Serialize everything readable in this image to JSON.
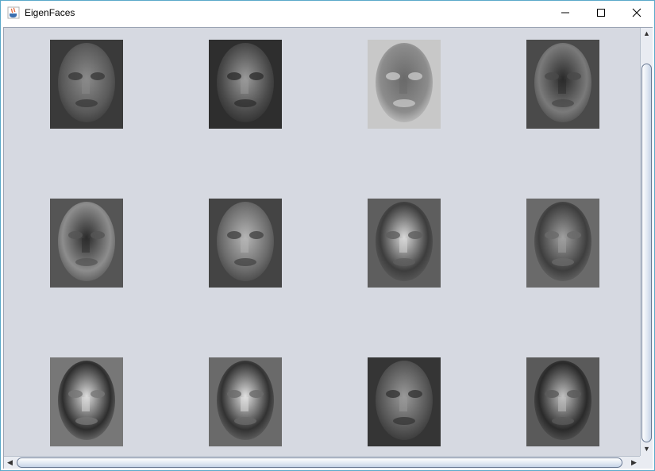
{
  "window": {
    "title": "EigenFaces",
    "icon": "java-coffee-cup-icon"
  },
  "controls": {
    "minimize_icon": "minimize-icon",
    "maximize_icon": "maximize-icon",
    "close_icon": "close-icon"
  },
  "eigenfaces": {
    "rows": 3,
    "columns": 4,
    "count": 12
  },
  "scrollbars": {
    "vertical": {
      "up_icon": "arrow-up-icon",
      "down_icon": "arrow-down-icon"
    },
    "horizontal": {
      "left_icon": "arrow-left-icon",
      "right_icon": "arrow-right-icon"
    }
  }
}
